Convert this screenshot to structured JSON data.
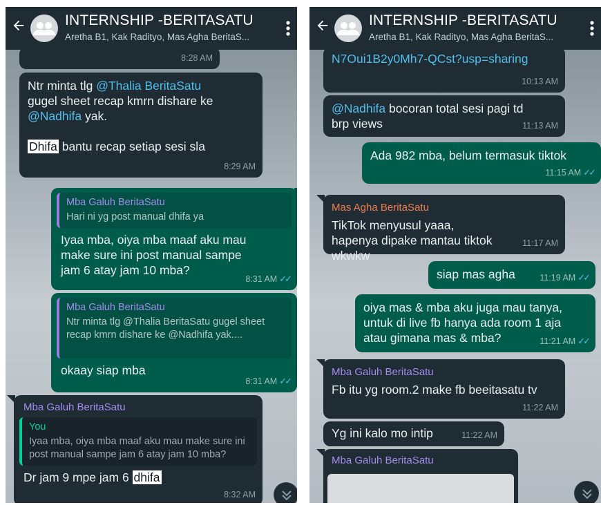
{
  "header": {
    "title": "INTERNSHIP -BERITASATU",
    "subtitle": "Aretha B1, Kak Radityo, Mas Agha BeritaS..."
  },
  "left": {
    "top_time": "8:28 AM",
    "msg1": {
      "line1_pre": "Ntr minta tlg ",
      "mention1": "@Thalia BeritaSatu",
      "line2": "gugel sheet recap kmrn dishare ke",
      "mention2": "@Nadhifa",
      "line3_post": " yak.",
      "highlight": "Dhifa",
      "line4_post": " bantu recap setiap sesi sla",
      "time": "8:29 AM"
    },
    "msg2": {
      "quote_sender": "Mba Galuh BeritaSatu",
      "quote_text": "Hari ni yg post manual dhifa ya",
      "text": "Iyaa mba, oiya mba maaf aku mau make sure ini post manual sampe jam 6 atay jam 10 mba?",
      "time": "8:31 AM",
      "tick": "✓✓"
    },
    "msg3": {
      "quote_sender": "Mba Galuh BeritaSatu",
      "quote_text": "Ntr minta tlg @Thalia BeritaSatu gugel sheet recap kmrn dishare ke @Nadhifa yak....",
      "text": "okaay siap mba",
      "time": "8:31 AM",
      "tick": "✓✓"
    },
    "msg4": {
      "sender": "Mba Galuh BeritaSatu",
      "quote_sender": "You",
      "quote_text": "Iyaa mba, oiya mba maaf aku mau make sure ini post manual sampe jam 6 atay jam 10 mba?",
      "text_pre": "Dr jam 9 mpe jam 6 ",
      "highlight": "dhifa",
      "time": "8:32 AM"
    }
  },
  "right": {
    "msg1": {
      "link": "N7Oui1B2y0Mh7-QCst?usp=sharing",
      "time": "10:13 AM"
    },
    "msg2": {
      "mention": "@Nadhifa",
      "text_post": " bocoran total sesi pagi td brp views",
      "time": "11:13 AM"
    },
    "msg3": {
      "text": "Ada 982 mba, belum termasuk tiktok",
      "time": "11:15 AM",
      "tick": "✓✓"
    },
    "msg4": {
      "sender": "Mas Agha BeritaSatu",
      "text": "TikTok menyusul yaaa, hapenya dipake mantau tiktok wkwkw",
      "time": "11:17 AM"
    },
    "msg5": {
      "text": "siap mas agha",
      "time": "11:19 AM",
      "tick": "✓✓"
    },
    "msg6": {
      "text": "oiya mas & mba aku juga mau tanya, untuk di live fb hanya ada room 1 aja atau gimana mas & mba?",
      "time": "11:21 AM",
      "tick": "✓✓"
    },
    "msg7": {
      "sender": "Mba Galuh BeritaSatu",
      "text": "Fb itu yg room.2 make fb beeitasatu tv",
      "time": "11:22 AM"
    },
    "msg8": {
      "text": "Yg ini kalo mo intip",
      "time": "11:22 AM"
    },
    "msg9": {
      "sender": "Mba Galuh BeritaSatu"
    }
  },
  "icons": {
    "back": "arrow-left",
    "avatar": "group-avatar",
    "menu": "more-vertical",
    "scroll": "chevron-double-down"
  }
}
